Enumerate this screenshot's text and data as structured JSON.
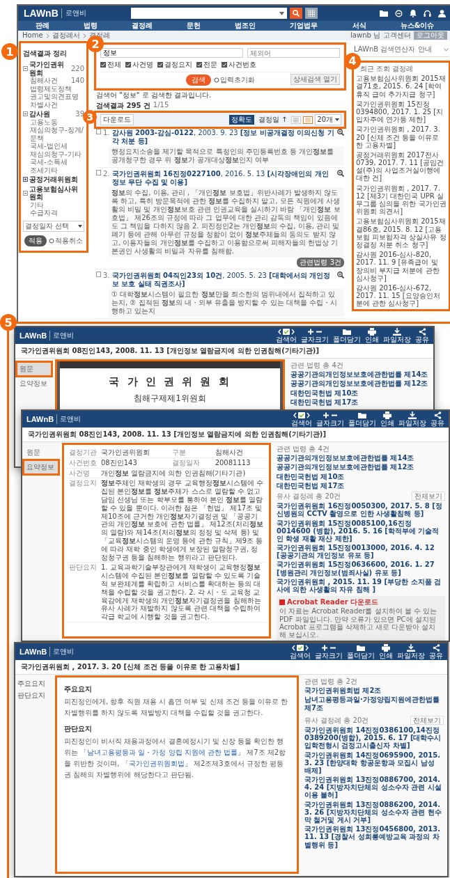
{
  "callouts": [
    "1",
    "2",
    "3",
    "4",
    "5"
  ],
  "main": {
    "logo": "LAWnB",
    "logo_sub": "로앤비",
    "nav": [
      "판례",
      "법령",
      "결정례",
      "문헌",
      "법조인",
      "기업법무",
      "서식",
      "뉴스&이슈"
    ],
    "breadcrumb": [
      "Home",
      "결정례서",
      "결정례"
    ],
    "user_links": [
      "lawnb 님",
      "고객센터",
      "로그아웃"
    ],
    "sidebar": {
      "title": "검색결과 정리",
      "groups": [
        {
          "label": "국가인권위원회",
          "count": "220",
          "expanded": true,
          "children": [
            {
              "label": "침해사건",
              "count": "140"
            },
            {
              "label": "법령제도정책"
            },
            {
              "label": "권고및의견표명"
            },
            {
              "label": "차별사건"
            }
          ]
        },
        {
          "label": "감사원",
          "count": "39",
          "expanded": true,
          "children": [
            {
              "label": "고용노동"
            },
            {
              "label": "재심의청구-징계/문책"
            },
            {
              "label": "국세-법인세"
            },
            {
              "label": "재심의청구-기타"
            },
            {
              "label": "국세-소득세"
            },
            {
              "label": "조세기타"
            }
          ]
        },
        {
          "label": "공정거래위원회",
          "expanded": false
        },
        {
          "label": "고용보험심사위원회",
          "expanded": true,
          "children": [
            {
              "label": "기타"
            },
            {
              "label": "수급자격"
            }
          ]
        }
      ],
      "date_placeholder": "결정일자 선택",
      "apply": "적용",
      "cancel": "적용취소"
    },
    "search": {
      "value": "정보",
      "placeholder": "제외어",
      "options": [
        {
          "label": "전체",
          "checked": true
        },
        {
          "label": "사건명",
          "checked": true
        },
        {
          "label": "결정요지",
          "checked": true
        },
        {
          "label": "전문",
          "checked": true
        },
        {
          "label": "사건번호",
          "checked": true
        }
      ],
      "submit": "검색",
      "reset": "입력초기화",
      "advanced": "상세검색 열기"
    },
    "summary": "검색어 \"정보\" 로 검색한 결과입니다.",
    "count": "검색결과 295 건",
    "page": "1/15",
    "toolbar": {
      "download": "다운로드",
      "sorts": [
        {
          "label": "정확도",
          "selected": true
        },
        {
          "label": "결정일 ↑",
          "selected": false
        }
      ],
      "views": [
        {
          "kind": "list",
          "selected": false
        },
        {
          "kind": "detail",
          "selected": true
        }
      ],
      "page_size": "20개"
    },
    "results": [
      {
        "number": "1.",
        "case": "감사원 2003-감심-0122",
        "date": ", 2003. 9. 23",
        "subject": "[**정보** 비공개결정 이의신청 기각 처분 등]",
        "snippet": "행정요지소송을 제기할 목적으로 특정인의 주민등록번호 등 개인**정보**를 공개청구한 경우 위 **정보**가 공개대상**정보**인지 여부"
      },
      {
        "number": "2.",
        "case": "국가인권위원회 16진정0227100",
        "date": ", 2016. 5. 13",
        "subject": "[시각장애인의 개인**정보** 무단 수집 및 이용]",
        "snippet": "**정보**의 수집, 이용, 관리 , 「개인**정보** 보호법」위반사례가 발생하지 않도록 하고, 특히 방문목적에 관한 **정보**를 수집하지 말고, 모든 직원에게 사생활의 비밀 및 개인**정보**보호 관련 인권교육을 실시하기 바람 「개인**정보** 보호법」 제26조의 규정에 따라 그 업무에 대한 관리 감독의 책임이 있음에도 그 책임을 다하지 않음 2. 피진정인2는 개인**정보**의 수집, 이용, 관리 및 폐기 등에 관해 아무런 규정을 정함이 없이 **정보**주체들의 동의도 받지 않고, 이용자들의 개인**정보**를 수집하고 이용함으로써 피해자들의 헌법상 기본권인 사생활의 비밀과 자유를 침해함.",
        "badge": "관련법령 3건"
      },
      {
        "number": "3.",
        "case": "국가인권위원회 04직인23외 10건",
        "date": ", 2005. 5. 23",
        "subject": "[대학에서의 개인**정보** 보호 실태 직권조사]",
        "snippet": "① 대학**정보**시스템이 필요한 **정보**만을 최소한의 범위내에서 집적하고 있는지, ② 집적된 **정보**의 내・외부 유출을 방지할 수 있는 대책을 수립・시행하고 있는지"
      }
    ],
    "right": {
      "guide": "LAWnB 검색연산자 안내",
      "recent_title": "최근 조회 결정례",
      "recent": [
        "고용보험심사위원회 2015재결71호, 2015. 6. 24 [학여휴직 급여 추가지급 청구]",
        "국가인권위원회 15진정0394800, 2017. 1. 25 [지입차주에 연가등 제한]",
        "국가인권위원회 , 2017. 3. 20 [신체 조건 등을 이유로 한 고용차별]",
        "공정거래위원회 2017전사0739, 2017. 7. 11 [공임건설(주)의 사업조거실이행에 대한 건]",
        "국가인권위원회 , 2017. 7. 12 [제3기 대한민국 UPR 실무그룹 심의을 위한 국가인권위원회 의견서]",
        "고용보험심사위원회 2015재결86호, 2015. 8. 12 [고용보험 피보험자격 상실사유 정정결정 처분 취소 청구]",
        "감사원 2016-심사-820, 2017. 11. 9 [유족급여 및 장의비 부지급 처분에 관한 심사청구]",
        "감사원 2016-심사-672, 2017. 11. 15 [요양승인처분에 관한 심사청구]"
      ]
    }
  },
  "windows": [
    {
      "kind": "pdf",
      "logo": "LAWnB",
      "logo_sub": "로앤비",
      "tools": [
        {
          "kind": "nav",
          "label": "검색어"
        },
        {
          "kind": "zoom",
          "label": "글자크기"
        },
        {
          "kind": "folder",
          "label": "폴더담기"
        },
        {
          "kind": "print",
          "label": "인쇄"
        },
        {
          "kind": "save",
          "label": "파일저장"
        },
        {
          "kind": "share",
          "label": "공유"
        }
      ],
      "title": "국가인권위원회 08진인143, 2008. 11. 13 [개인정보 열람금지에 의한 인권침해(기타기관)]",
      "menu": [
        {
          "label": "원문",
          "selected": true
        },
        {
          "label": "요약정보",
          "selected": false
        }
      ],
      "pdf_lines": [
        "국 가 인 권 위 원 회",
        "침해구제제1위원회"
      ],
      "laws_title": "관련 법령 총 4건",
      "laws": [
        "공공기관의개인정보보호에관한법률 제14조",
        "공공기관의개인정보보호에관한법률 제12조",
        "대한민국헌법 제10조",
        "대한민국헌법 제17조"
      ]
    },
    {
      "kind": "table",
      "logo": "LAWnB",
      "logo_sub": "로앤비",
      "tools": [
        {
          "kind": "nav",
          "label": "검색어"
        },
        {
          "kind": "zoom",
          "label": "글자크기"
        },
        {
          "kind": "folder",
          "label": "폴더담기"
        },
        {
          "kind": "print",
          "label": "인쇄"
        },
        {
          "kind": "save",
          "label": "파일저장"
        },
        {
          "kind": "share",
          "label": "공유"
        }
      ],
      "title": "국가인권위원회 08진인143, 2008. 11. 13 [개인정보 열람금지에 의한 인권침해(기타기관)]",
      "menu": [
        {
          "label": "원문",
          "selected": false
        },
        {
          "label": "요약정보",
          "selected": true
        }
      ],
      "pairs": [
        [
          "결정기관",
          "국가인권위원회",
          "구분",
          "침해사건"
        ],
        [
          "사건번호",
          "08진인143",
          "결정일자",
          "20081113"
        ]
      ],
      "rows": [
        {
          "label": "사건명",
          "text": "개인**정보** 열람금지에 의한 인권침해(기타기관)"
        },
        {
          "label": "결정요지",
          "text": "**정보**주체인 재학생의 경우 교육행정**정보**시스템에 수집된 본인**정보**를 **정보**주체가 스스로 열람할 수 없고 담임 선생님 또는 학부모를 통하여 본인 **정보**를 열람할 수 있을 뿐이다. 이러한 점은 「헌법」 제17조 및 제10조에 근거한 개인**정보**자기결정권 및 「공공기관의 개인**정보** 보호에 관한 법률」 제12조(처리**정보**의 열람)와 제14조(처리**정보**의 정정 및 삭제 등) 및 「교육**정보**시스템의 운영 등에 관한 규칙」제9조 등에 따라 재학 중인 학생에게 보장된 열람청구권, 정정청구권 등을 침해하는 행위라고 판단된다."
        },
        {
          "label": "판단요지",
          "text": "1. 교육과학기술부장관에게 재학생이 교육행정**정보**시스템에 수집된 본인**정보**를 열람할 수 있도록 기술적 보완체계를 확립하고 서비스를 확대하는 등의 대책을 수립할 것을 권고한다. 2. 각 시・도 교육청 교육감에게 재학생의 개인**정보**자기결정권을 침해하는 유사 사례가 재발하지 않도록 관련 대책을 수립하여 각급 학교에 시행할 것을 권고한다."
        }
      ],
      "laws_title": "관련 법령 총 4건",
      "laws": [
        "공공기관의개인정보보호에관한법률 제14조",
        "공공기관의개인정보보호에관한법률 제12조",
        "대한민국헌법 제10조",
        "대한민국헌법 제17조"
      ],
      "similar_title": "유사 결정례 총 20건",
      "similar_all": "전체보기",
      "similar": [
        "국가인권위원회 16진정0050300, 2017. 5. 8 [정신병원의 CCTV 촬영으로 인한 사생활침해 등]",
        "국가인권위원회 15진정0085100,16진정0014600 (병합), 2016. 5. 16 [학적부에 기술적인 학생 재활 재산 제한]",
        "국가인권위원회 15진정0013000, 2016. 4. 12 [공공기관의 개인정보 유포 등]",
        "국가인권위원회 15진정0636600, 2016. 1. 27 [병원관리 개인정보(범죄사실) 유포 등]",
        "국가인권위원회 , 2015. 11. 19 [부당한 소지품 검사에 의한 사생활의 자유 침해 ]"
      ],
      "acrobat_title": "Acrobat Reader 다운로드",
      "acrobat_text": "이 자료는 Acrobat Reader를 설치하여 볼 수 있는 PDF 파일입니다. 만약 오류가 있으면 PC에 설치된 Acrobat 프로그램을 삭제하고 새로 다운받아 설치해 보십시오."
    },
    {
      "kind": "gist",
      "logo": "LAWnB",
      "logo_sub": "로앤비",
      "tools": [
        {
          "kind": "nav",
          "label": "검색어"
        },
        {
          "kind": "zoom",
          "label": "글자크기"
        },
        {
          "kind": "folder",
          "label": "폴더담기"
        },
        {
          "kind": "print",
          "label": "인쇄"
        },
        {
          "kind": "save",
          "label": "파일저장"
        },
        {
          "kind": "share",
          "label": "공유"
        }
      ],
      "title": "국가인권위원회 , 2017. 3. 20 [신체 조건 등을 이유로 한 고용차별]",
      "menu": [
        {
          "label": "주요요지",
          "selected": false
        },
        {
          "label": "판단요지",
          "selected": false
        }
      ],
      "sections": [
        {
          "heading": "주요요지",
          "parts": [
            {
              "kind": "text",
              "text": "피진정인에게, 향후 직원 채용 시 흡연 여부 및 신체 조건 등을 이유로 한 차별행위를 하지 않도록 재발방지 대책을 수립할 것을 권고한다."
            }
          ]
        },
        {
          "heading": "판단요지",
          "parts": [
            {
              "kind": "text",
              "text": "피진정인이 비서직 채용과정에서 결혼예정시기 및 신장 등을 확인한 행위는 "
            },
            {
              "kind": "link",
              "text": "「남녀고용평등과 일・가정 양립 지원에 관한 법률」"
            },
            {
              "kind": "text",
              "text": " 제7조 제2항을 위반한 것이며, "
            },
            {
              "kind": "link",
              "text": "「국가인권위원회법」"
            },
            {
              "kind": "text",
              "text": " 제2조제3호에서 규정한 평등권 침해의 차별행위에 해당한다고 판단됨."
            }
          ]
        }
      ],
      "laws_title": "관련 법령 총 2건",
      "laws": [
        "국가인권위원회법 제2조",
        "남녀고용평등과일·가정양립지원에관한법률 제7조"
      ],
      "similar_title": "유사 결정례 총 20건",
      "similar_all": "전체보기",
      "similar": [
        "국가인권위원회 14진정0386100,14진정0389200(병합), 2015. 6. 17 [대학수시입학전형시 검정고시출신자 차별]",
        "국가인권위원회 14진정0695900, 2015. 3. 23 [한양대학 항공운항과 모집시 남성 배제]",
        "국가인권위원회 13진정0886700, 2014. 4. 24 [지방자치단체의 성소수자 관련 시설이용 불허]",
        "국가인권위원회 13진정0886200, 2014. 3. 26 [지방자치단체의 성소수자 관련 현수막 철거및 게시 거부]",
        "국가인권위원회 13진정0456800, 2013. 11. 13 [경찰서 성희롱예방교육 과정의 차별행위 등]"
      ]
    }
  ]
}
